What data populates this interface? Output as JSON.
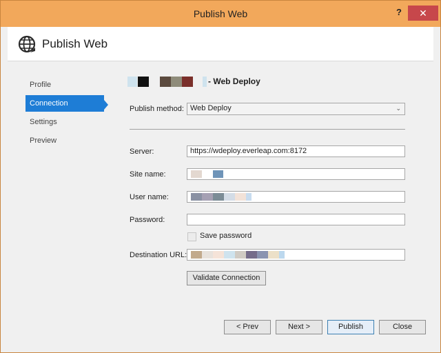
{
  "window": {
    "title": "Publish Web",
    "help_glyph": "?",
    "close_glyph": "✕"
  },
  "header": {
    "title": "Publish Web",
    "icon": "globe-icon"
  },
  "sidebar": {
    "items": [
      {
        "label": "Profile",
        "active": false
      },
      {
        "label": "Connection",
        "active": true
      },
      {
        "label": "Settings",
        "active": false
      },
      {
        "label": "Preview",
        "active": false
      }
    ]
  },
  "main": {
    "profile_suffix": "- Web Deploy",
    "publish_method": {
      "label": "Publish method:",
      "value": "Web Deploy"
    },
    "server": {
      "label": "Server:",
      "value": "https://wdeploy.everleap.com:8172"
    },
    "site_name": {
      "label": "Site name:"
    },
    "user_name": {
      "label": "User name:"
    },
    "password": {
      "label": "Password:",
      "value": ""
    },
    "save_password": {
      "label": "Save password",
      "checked": false
    },
    "destination_url": {
      "label": "Destination URL:"
    },
    "validate_label": "Validate Connection"
  },
  "footer": {
    "prev_label": "< Prev",
    "next_label": "Next >",
    "publish_label": "Publish",
    "close_label": "Close"
  },
  "colors": {
    "titlebar": "#f2a85b",
    "accent": "#1e7dd6",
    "close": "#c7474b"
  }
}
